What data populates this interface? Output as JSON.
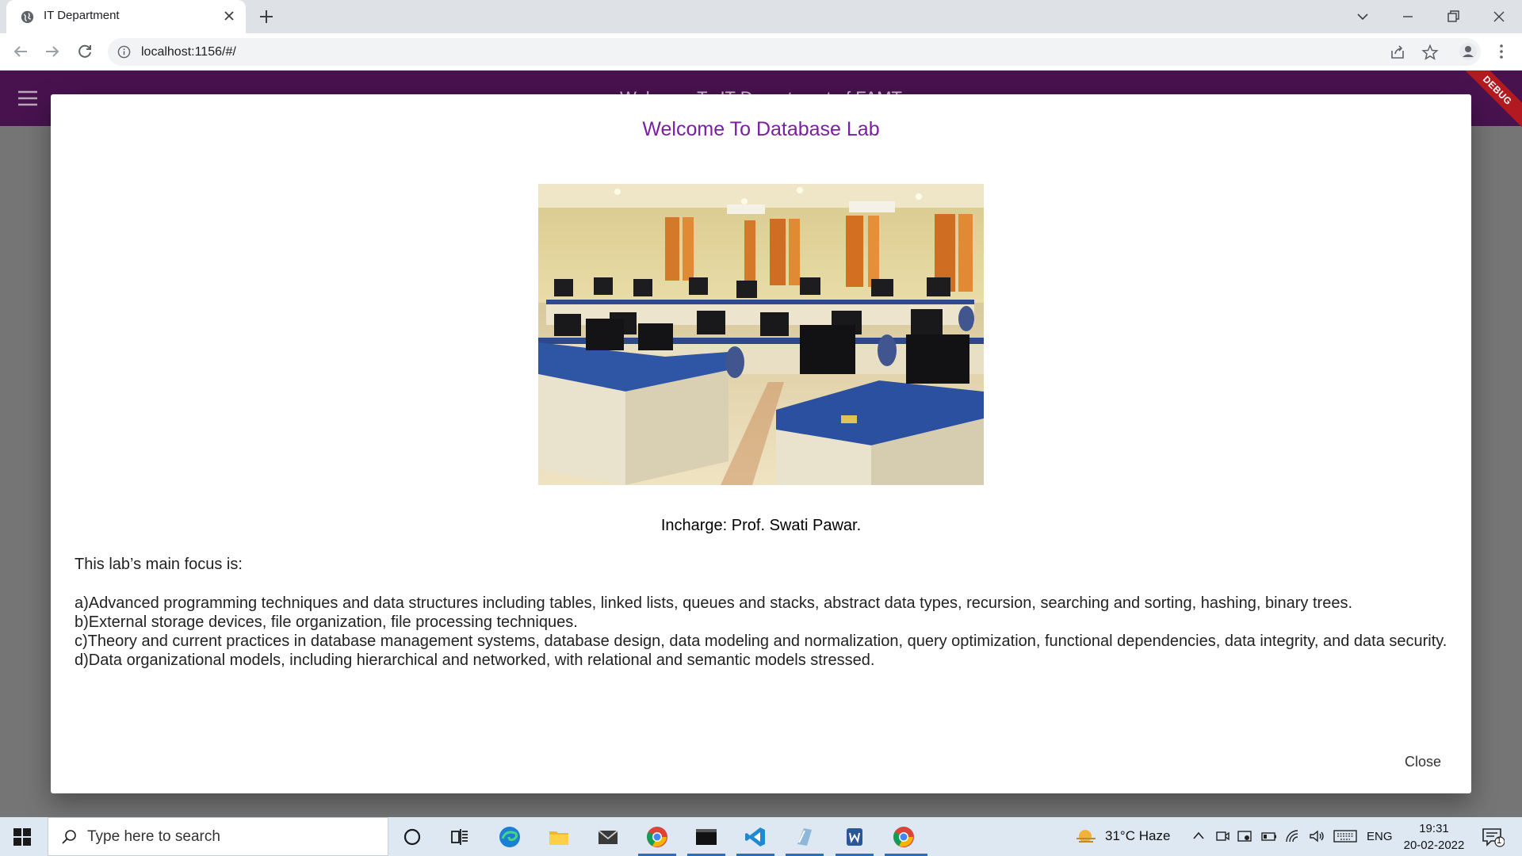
{
  "browser": {
    "tab_title": "IT Department",
    "url": "localhost:1156/#/"
  },
  "app": {
    "appbar_title": "Welcome To IT Department of FAMT",
    "debug_label": "DEBUG",
    "colors": {
      "appbar": "#48124f",
      "dialog_title": "#7b1fa2",
      "overlay": "#757575"
    }
  },
  "dialog": {
    "title": "Welcome To Database Lab",
    "photo_icon": "computer-lab-photo",
    "incharge": "Incharge: Prof. Swati Pawar.",
    "focus_intro": "This lab’s main focus is:",
    "points": [
      "a)Advanced programming techniques and data structures including tables, linked lists, queues and stacks, abstract data types, recursion, searching and sorting, hashing, binary trees.",
      "b)External storage devices, file organization, file processing techniques.",
      "c)Theory and current practices in database management systems, database design, data modeling and normalization, query optimization, functional dependencies, data integrity, and data security.",
      "d)Data organizational models, including hierarchical and networked, with relational and semantic models stressed."
    ],
    "close_label": "Close"
  },
  "taskbar": {
    "search_placeholder": "Type here to search",
    "weather": "31°C  Haze",
    "language": "ENG",
    "time": "19:31",
    "date": "20-02-2022",
    "notification_count": "1"
  }
}
